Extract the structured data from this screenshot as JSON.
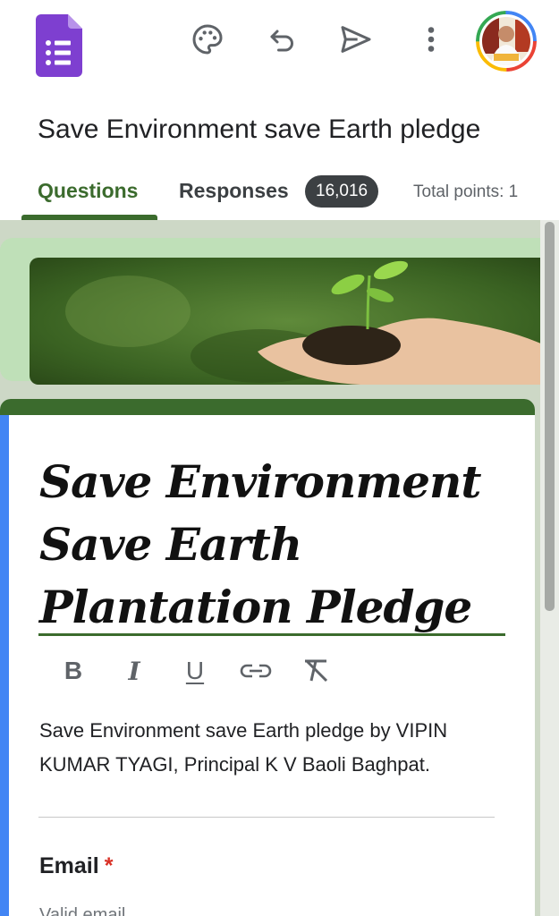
{
  "app": {
    "icon": "google-forms-icon"
  },
  "toolbar": {
    "icons": [
      "palette-icon",
      "undo-icon",
      "send-icon",
      "more-vert-icon"
    ],
    "avatar": "user-avatar"
  },
  "form": {
    "title": "Save Environment save Earth pledge"
  },
  "tabs": {
    "questions": "Questions",
    "responses": "Responses",
    "responses_count": "16,016",
    "total_points": "Total points: 1"
  },
  "card": {
    "title_lines": [
      "Save Environment",
      "Save Earth",
      "Plantation Pledge"
    ],
    "format_buttons": {
      "bold": "B",
      "italic": "I",
      "underline": "U"
    },
    "description": "Save Environment save Earth pledge by VIPIN KUMAR TYAGI, Principal K V Baoli Baghpat."
  },
  "question": {
    "label": "Email",
    "required_mark": "*",
    "hint": "Valid email"
  },
  "colors": {
    "accent": "#3b6b2d",
    "badge": "#3c4043",
    "content_bg": "#cdd8c6",
    "left_accent": "#4285f4",
    "forms_purple": "#7e3fd0"
  }
}
